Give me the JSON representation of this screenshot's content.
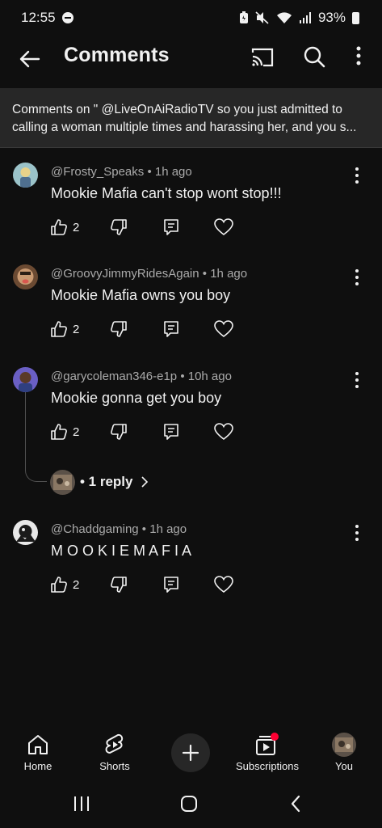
{
  "status_bar": {
    "time": "12:55",
    "battery": "93%"
  },
  "header": {
    "title": "Comments"
  },
  "banner": {
    "line1": "Comments on \" @LiveOnAiRadioTV  so you just admitted to",
    "line2": "calling a woman multiple times and harassing her, and you s..."
  },
  "comments": [
    {
      "author": "@Frosty_Speaks",
      "time": " • 1h ago",
      "text": "Mookie Mafia can't stop wont stop!!!",
      "likes": "2"
    },
    {
      "author": "@GroovyJimmyRidesAgain",
      "time": " • 1h ago",
      "text": "Mookie Mafia owns you boy",
      "likes": "2"
    },
    {
      "author": "@garycoleman346-e1p",
      "time": " • 10h ago",
      "text": "Mookie gonna get you boy",
      "likes": "2",
      "replies": "• 1 reply"
    },
    {
      "author": "@Chaddgaming",
      "time": " • 1h ago",
      "text": "M O O K I E M A F I A",
      "likes": "2"
    }
  ],
  "bottom_nav": {
    "home": "Home",
    "shorts": "Shorts",
    "subscriptions": "Subscriptions",
    "you": "You"
  },
  "colors": {
    "background": "#0f0f0f",
    "banner": "#272727",
    "notification_dot": "#ff0033"
  }
}
